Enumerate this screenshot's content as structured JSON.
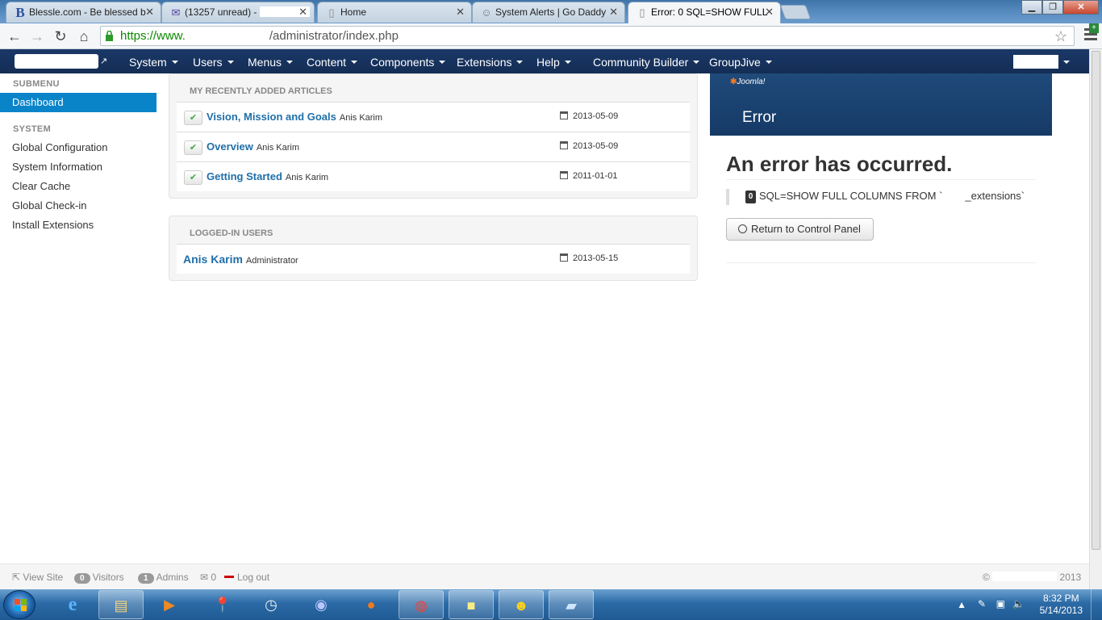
{
  "browser": {
    "tabs": [
      {
        "title": "Blessle.com - Be blessed b",
        "icon": "blessle-favicon"
      },
      {
        "title": "(13257 unread) -",
        "icon": "mail-favicon"
      },
      {
        "title": "Home",
        "icon": "page-favicon"
      },
      {
        "title": "System Alerts | Go Daddy ",
        "icon": "godaddy-favicon"
      },
      {
        "title": "Error: 0 SQL=SHOW FULL",
        "icon": "page-favicon",
        "active": true
      }
    ],
    "url_scheme": "https://www.",
    "url_path": "/administrator/index.php"
  },
  "navbar": {
    "menus": [
      "System",
      "Users",
      "Menus",
      "Content",
      "Components",
      "Extensions",
      "Help",
      "Community Builder",
      "GroupJive"
    ]
  },
  "sidebar": {
    "submenu_heading": "SUBMENU",
    "dashboard_label": "Dashboard",
    "system_heading": "SYSTEM",
    "items": [
      "Global Configuration",
      "System Information",
      "Clear Cache",
      "Global Check-in",
      "Install Extensions"
    ]
  },
  "recent_articles": {
    "heading": "MY RECENTLY ADDED ARTICLES",
    "rows": [
      {
        "title": "Vision, Mission and Goals",
        "author": "Anis Karim",
        "date": "2013-05-09"
      },
      {
        "title": "Overview",
        "author": "Anis Karim",
        "date": "2013-05-09"
      },
      {
        "title": "Getting Started",
        "author": "Anis Karim",
        "date": "2011-01-01"
      }
    ]
  },
  "logged_in": {
    "heading": "LOGGED-IN USERS",
    "rows": [
      {
        "name": "Anis Karim",
        "role": "Administrator",
        "date": "2013-05-15"
      }
    ]
  },
  "error": {
    "brand": "Joomla!",
    "header_title": "Error",
    "heading": "An error has occurred.",
    "code": "0",
    "message": "SQL=SHOW FULL COLUMNS FROM `",
    "message_tail": "_extensions`",
    "return_button": "Return to Control Panel"
  },
  "status": {
    "view_site": "View Site",
    "visitors_count": "0",
    "visitors_label": "Visitors",
    "admins_count": "1",
    "admins_label": "Admins",
    "messages_count": "0",
    "logout_label": "Log out",
    "copyright_prefix": "©",
    "copyright_year": "2013"
  },
  "taskbar": {
    "time": "8:32 PM",
    "date": "5/14/2013"
  },
  "colors": {
    "navbar_bg": "#1a3867",
    "accent": "#0a84c9",
    "link": "#1f6fa8",
    "error_header": "#1f4a7a"
  }
}
